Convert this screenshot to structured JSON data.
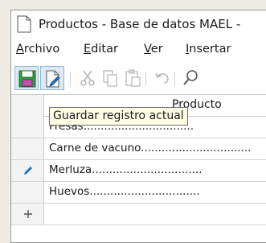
{
  "window": {
    "title": "Productos - Base de datos MAEL -"
  },
  "menubar": {
    "items": [
      {
        "mnemonic": "A",
        "rest": "rchivo"
      },
      {
        "mnemonic": "E",
        "rest": "ditar"
      },
      {
        "mnemonic": "V",
        "rest": "er"
      },
      {
        "mnemonic": "I",
        "rest": "nsertar"
      }
    ]
  },
  "toolbar": {
    "buttons": [
      {
        "icon": "save-record-icon",
        "active": true
      },
      {
        "icon": "edit-document-icon",
        "active": true
      },
      {
        "icon": "cut-icon",
        "active": false
      },
      {
        "icon": "copy-icon",
        "active": false
      },
      {
        "icon": "paste-icon",
        "active": false
      },
      {
        "icon": "undo-icon",
        "active": false
      },
      {
        "icon": "search-icon",
        "active": false
      }
    ],
    "tooltip": "Guardar registro actual"
  },
  "grid": {
    "column_header": "Producto",
    "rows": [
      {
        "value": "Fresas",
        "dots": "................................",
        "indicator": ""
      },
      {
        "value": "Carne de vacuno",
        "dots": "................................",
        "indicator": ""
      },
      {
        "value": "Merluza",
        "dots": "................................",
        "indicator": "edit-pencil-icon"
      },
      {
        "value": "Huevos",
        "dots": "................................",
        "indicator": ""
      },
      {
        "value": "",
        "dots": "",
        "indicator": "new-row-icon"
      }
    ]
  },
  "colors": {
    "accent_blue": "#1f6fc2",
    "save_green": "#2e9e3e",
    "tooltip_bg": "#ffffe6"
  }
}
